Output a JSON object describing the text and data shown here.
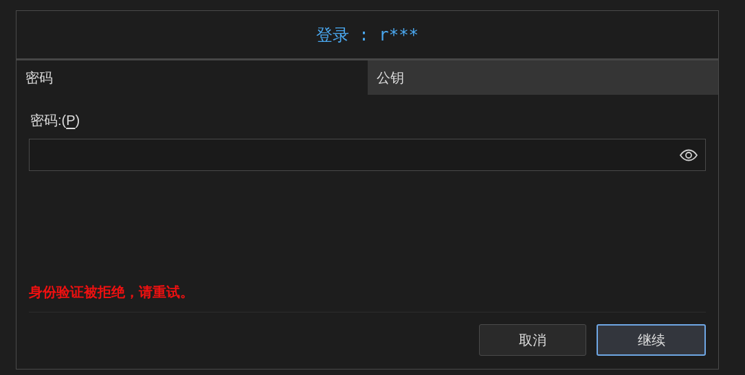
{
  "dialog": {
    "title": "登录 : r***"
  },
  "tabs": [
    {
      "label": "密码",
      "selected": true
    },
    {
      "label": "公钥",
      "selected": false
    }
  ],
  "password_field": {
    "label_before": "密码:(",
    "access_key": "P",
    "label_after": ")"
  },
  "error": "身份验证被拒绝，请重试。",
  "buttons": [
    {
      "label": "取消",
      "default": false
    },
    {
      "label": "继续",
      "default": true
    }
  ]
}
